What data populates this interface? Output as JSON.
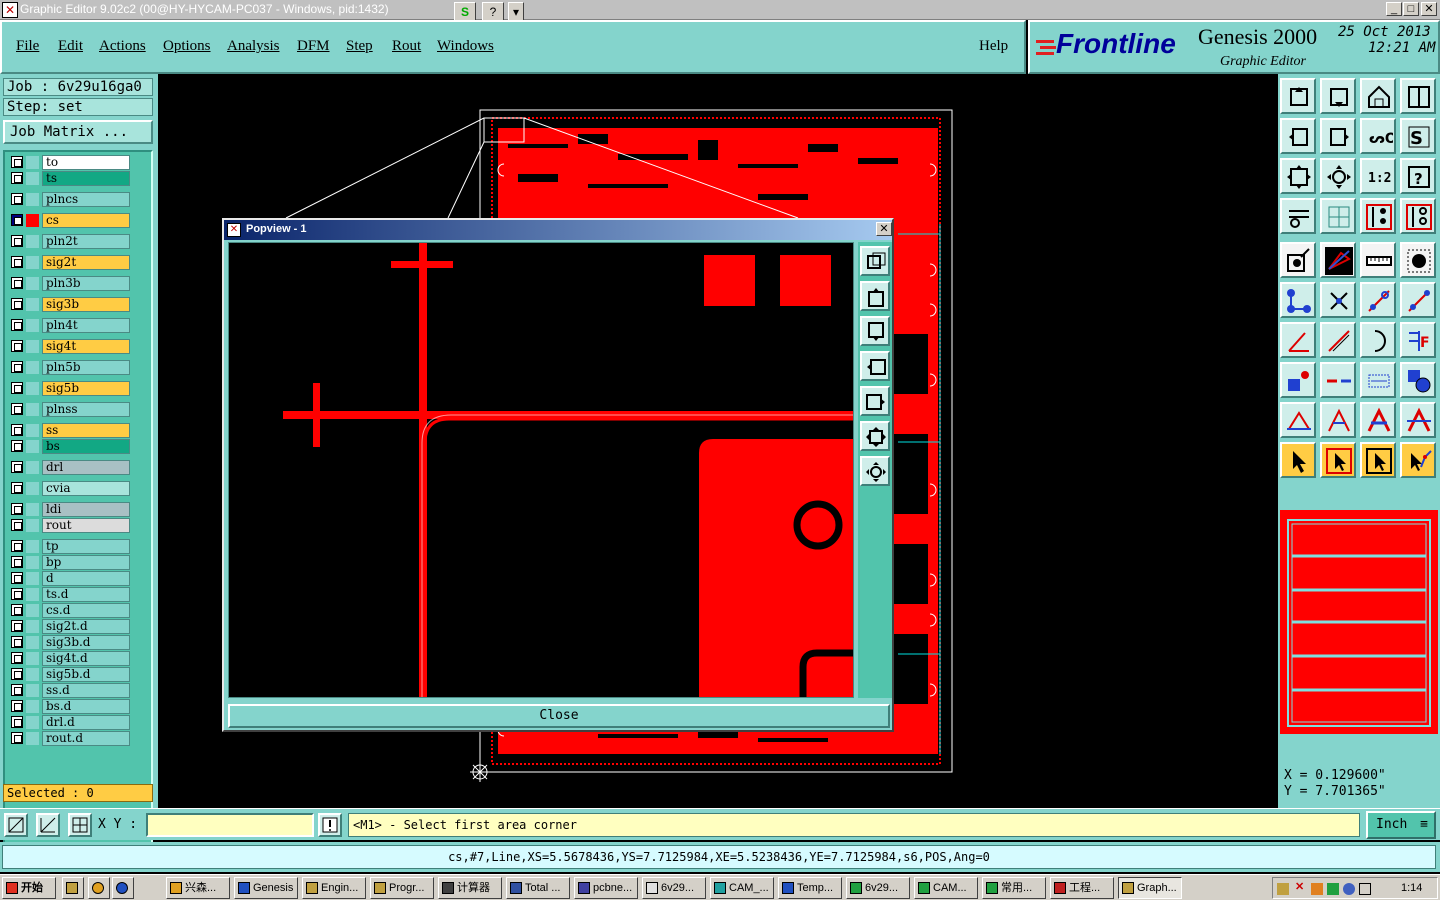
{
  "window": {
    "title": "Graphic Editor 9.02c2 (00@HY-HYCAM-PC037 - Windows, pid:1432)",
    "toolbar_s": "S",
    "toolbar_help": "?",
    "toolbar_more": "▾",
    "minimize": "_",
    "maximize": "□",
    "close": "✕"
  },
  "menu": {
    "items": [
      "File",
      "Edit",
      "Actions",
      "Options",
      "Analysis",
      "DFM",
      "Step",
      "Rout",
      "Windows"
    ],
    "help": "Help"
  },
  "brand": {
    "logo": "Frontline",
    "product": "Genesis 2000",
    "module": "Graphic Editor",
    "date": "25 Oct 2013",
    "time": "12:21 AM"
  },
  "job": {
    "job_label": "Job  : 6v29u16ga0",
    "step_label": "Step: set",
    "matrix_button": "Job Matrix ..."
  },
  "layers": [
    {
      "name": "to",
      "color": "#ffffff"
    },
    {
      "name": "ts",
      "color": "#12a884"
    },
    {
      "name": "plncs",
      "color": "#84d4cc"
    },
    {
      "name": "cs",
      "color": "#ffcc44",
      "active": true
    },
    {
      "name": "pln2t",
      "color": "#84d4cc"
    },
    {
      "name": "sig2t",
      "color": "#ffcc44"
    },
    {
      "name": "pln3b",
      "color": "#84d4cc"
    },
    {
      "name": "sig3b",
      "color": "#ffcc44"
    },
    {
      "name": "pln4t",
      "color": "#84d4cc"
    },
    {
      "name": "sig4t",
      "color": "#ffcc44"
    },
    {
      "name": "pln5b",
      "color": "#84d4cc"
    },
    {
      "name": "sig5b",
      "color": "#ffcc44"
    },
    {
      "name": "plnss",
      "color": "#84d4cc"
    },
    {
      "name": "ss",
      "color": "#ffcc44"
    },
    {
      "name": "bs",
      "color": "#12a884"
    },
    {
      "name": "drl",
      "color": "#a8c0c4"
    },
    {
      "name": "cvia",
      "color": "#a8e4dc"
    },
    {
      "name": "ldi",
      "color": "#a8c0c4"
    },
    {
      "name": "rout",
      "color": "#dcdcdc"
    },
    {
      "name": "tp",
      "color": "#84d4cc"
    },
    {
      "name": "bp",
      "color": "#84d4cc"
    },
    {
      "name": "d",
      "color": "#84d4cc"
    },
    {
      "name": "ts.d",
      "color": "#84d4cc"
    },
    {
      "name": "cs.d",
      "color": "#84d4cc"
    },
    {
      "name": "sig2t.d",
      "color": "#84d4cc"
    },
    {
      "name": "sig3b.d",
      "color": "#84d4cc"
    },
    {
      "name": "sig4t.d",
      "color": "#84d4cc"
    },
    {
      "name": "sig5b.d",
      "color": "#84d4cc"
    },
    {
      "name": "ss.d",
      "color": "#84d4cc"
    },
    {
      "name": "bs.d",
      "color": "#84d4cc"
    },
    {
      "name": "drl.d",
      "color": "#84d4cc"
    },
    {
      "name": "rout.d",
      "color": "#84d4cc"
    }
  ],
  "selected": "Selected : 0",
  "popview": {
    "title": "Popview - 1",
    "close_button": "Close"
  },
  "coords": {
    "x": "X = 0.129600\"",
    "y": "Y = 7.701365\""
  },
  "command": {
    "xy_label": "X Y :",
    "xy_value": "",
    "prompt": "<M1> - Select first area corner",
    "unit": "Inch"
  },
  "status": "cs,#7,Line,XS=5.5678436,YS=7.7125984,XE=5.5238436,YE=7.7125984,s6,POS,Ang=0",
  "taskbar": {
    "start": "开始",
    "tasks": [
      "兴森...",
      "Genesis",
      "Engin...",
      "Progr...",
      "计算器",
      "Total ...",
      "pcbne...",
      "6v29...",
      "CAM_...",
      "Temp...",
      "6v29...",
      "CAM...",
      "常用...",
      "工程...",
      "Graph..."
    ],
    "clock": "1:14"
  },
  "colors": {
    "copper": "#ff0000",
    "panel": "#84d4cc",
    "highlight": "#ffcc44"
  }
}
